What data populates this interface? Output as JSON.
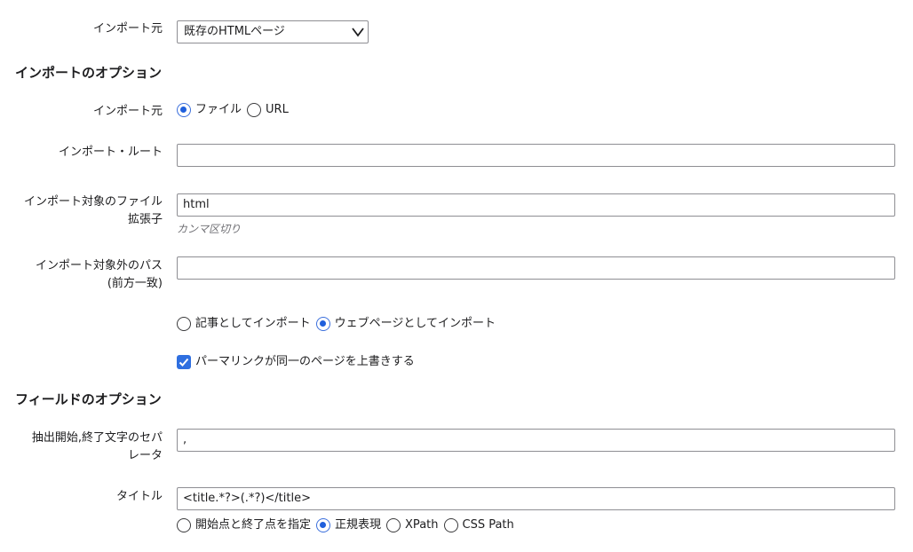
{
  "import_source_select": {
    "label": "インポート元",
    "value": "既存のHTMLページ"
  },
  "import_options": {
    "heading": "インポートのオプション",
    "source": {
      "label": "インポート元",
      "options": [
        "ファイル",
        "URL"
      ],
      "selected": "ファイル"
    },
    "import_root": {
      "label": "インポート・ルート",
      "value": ""
    },
    "extensions": {
      "label_line1": "インポート対象のファイル",
      "label_line2": "拡張子",
      "value": "html",
      "hint": "カンマ区切り"
    },
    "excluded_paths": {
      "label_line1": "インポート対象外のパス",
      "label_line2": "(前方一致)",
      "value": ""
    },
    "import_as": {
      "options": [
        "記事としてインポート",
        "ウェブページとしてインポート"
      ],
      "selected": "ウェブページとしてインポート"
    },
    "overwrite": {
      "label": "パーマリンクが同一のページを上書きする",
      "checked": true
    }
  },
  "field_options": {
    "heading": "フィールドのオプション",
    "separator": {
      "label_line1": "抽出開始,終了文字のセパ",
      "label_line2": "レータ",
      "value": ","
    },
    "title": {
      "label": "タイトル",
      "value": "<title.*?>(.*?)</title>"
    },
    "method": {
      "options": [
        "開始点と終了点を指定",
        "正規表現",
        "XPath",
        "CSS Path"
      ],
      "selected": "正規表現"
    }
  },
  "colors": {
    "accent": "#1f5fdc",
    "border": "#8e8e93",
    "hint": "#6e6e73"
  }
}
